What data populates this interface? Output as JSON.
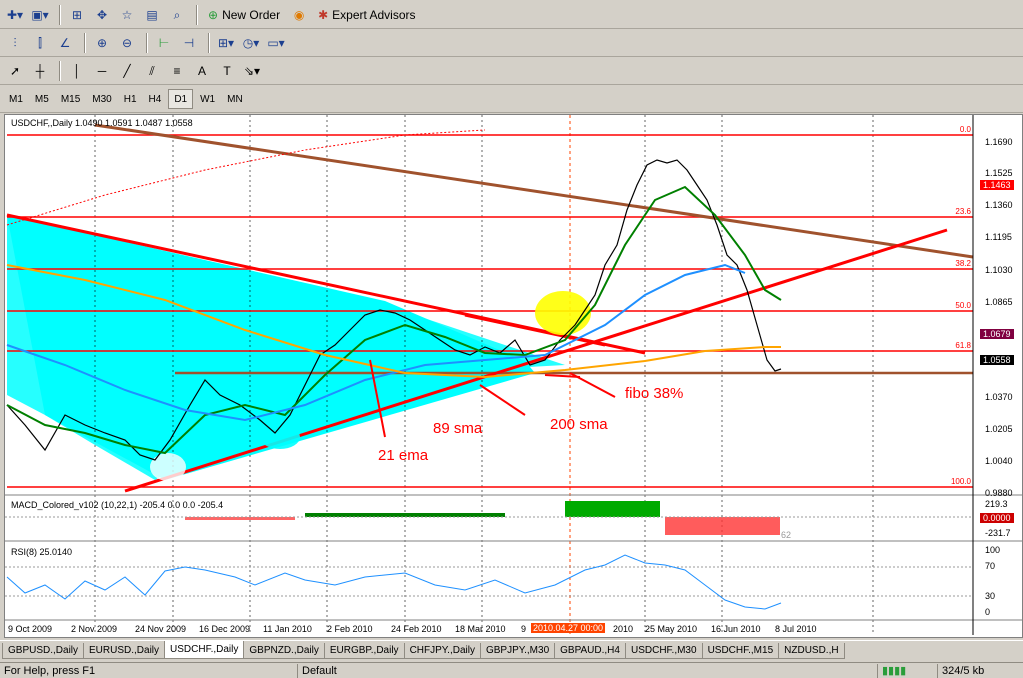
{
  "toolbar": {
    "new_order": "New Order",
    "expert_advisors": "Expert Advisors"
  },
  "timeframes": [
    "M1",
    "M5",
    "M15",
    "M30",
    "H1",
    "H4",
    "D1",
    "W1",
    "MN"
  ],
  "active_timeframe": "D1",
  "chart": {
    "header": "USDCHF,,Daily  1.0490 1.0591 1.0487 1.0558",
    "price_labels": [
      "1.1690",
      "1.1525",
      "1.1360",
      "1.1195",
      "1.1030",
      "1.0865",
      "1.0370",
      "1.0205",
      "1.0040",
      "0.9880"
    ],
    "badges": {
      "top": "1.1463",
      "mid": "1.0679",
      "current": "1.0558",
      "macd": "0.0000"
    },
    "fib_levels": [
      "0.0",
      "23.6",
      "38.2",
      "50.0",
      "61.8",
      "100.0"
    ],
    "date_labels": [
      "9 Oct 2009",
      "2 Nov 2009",
      "24 Nov 2009",
      "16 Dec 2009",
      "11 Jan 2010",
      "2 Feb 2010",
      "24 Feb 2010",
      "18 Mar 2010",
      "9",
      "2010.04.27 00:00",
      "2010",
      "25 May 2010",
      "16 Jun 2010",
      "8 Jul 2010"
    ],
    "annotations": {
      "ema": "21 ema",
      "sma89": "89 sma",
      "sma200": "200 sma",
      "fibo": "fibo 38%"
    }
  },
  "macd": {
    "label": "MACD_Colored_v102 (10,22,1) -205.4 0.0 0.0 -205.4",
    "axis": [
      "219.3",
      "-231.7"
    ],
    "value_tail": "62"
  },
  "rsi": {
    "label": "RSI(8) 25.0140",
    "axis": [
      "100",
      "70",
      "30",
      "0"
    ]
  },
  "tabs": [
    "GBPUSD.,Daily",
    "EURUSD.,Daily",
    "USDCHF.,Daily",
    "GBPNZD.,Daily",
    "EURGBP.,Daily",
    "CHFJPY.,Daily",
    "GBPJPY.,M30",
    "GBPAUD.,H4",
    "USDCHF.,M30",
    "USDCHF.,M15",
    "NZDUSD.,H"
  ],
  "active_tab": "USDCHF.,Daily",
  "status": {
    "help": "For Help, press F1",
    "profile": "Default",
    "traffic": "324/5 kb"
  },
  "colors": {
    "cyan_fill": "#00ffff",
    "red_line": "#ff0000",
    "brown_line": "#a0522d",
    "green_ma": "#008000",
    "blue_ma": "#1e90ff",
    "orange_ma": "#ffa500"
  }
}
